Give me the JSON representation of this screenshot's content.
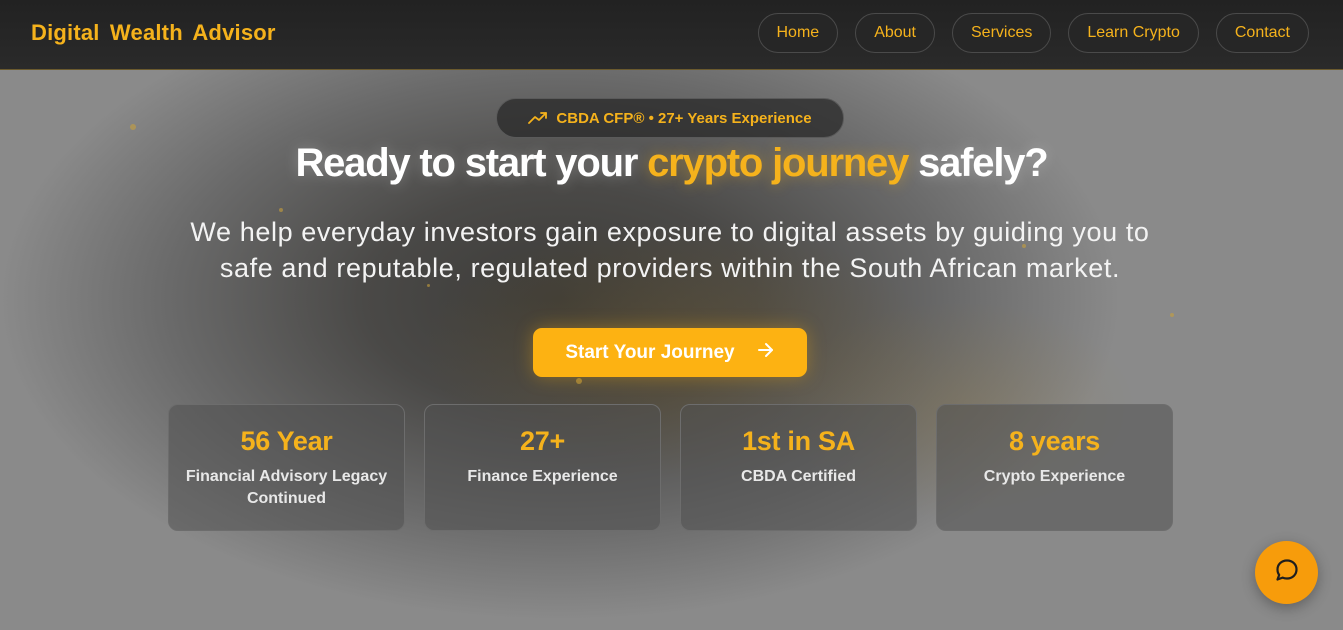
{
  "header": {
    "brand": "Digital Wealth Advisor",
    "nav": [
      {
        "label": "Home"
      },
      {
        "label": "About"
      },
      {
        "label": "Services"
      },
      {
        "label": "Learn Crypto"
      },
      {
        "label": "Contact"
      }
    ]
  },
  "hero": {
    "badge": {
      "icon": "trending-up-icon",
      "text": "CBDA CFP® • 27+ Years Experience"
    },
    "headline_before": "Ready to start your ",
    "headline_accent": "crypto journey",
    "headline_after": " safely?",
    "subtext": "We help everyday investors gain exposure to digital assets by guiding you to safe and reputable, regulated providers within the South African market.",
    "cta": {
      "label": "Start Your Journey",
      "icon": "arrow-right-icon"
    }
  },
  "stats": [
    {
      "value": "56 Year",
      "label": "Financial Advisory Legacy Continued"
    },
    {
      "value": "27+",
      "label": "Finance Experience"
    },
    {
      "value": "1st in SA",
      "label": "CBDA Certified"
    },
    {
      "value": "8 years",
      "label": "Crypto Experience"
    }
  ],
  "chat": {
    "icon": "chat-bubble-icon"
  },
  "colors": {
    "accent": "#f5b21c",
    "cta": "#fdb212",
    "chat_button": "#f79c0b",
    "header_bg": "#222222"
  }
}
